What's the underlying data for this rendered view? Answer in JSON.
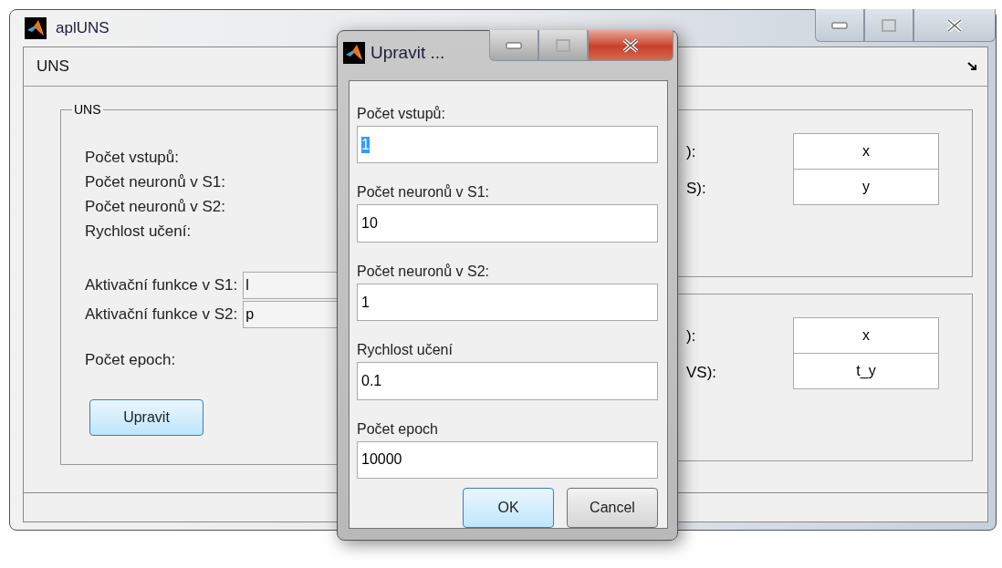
{
  "main_window": {
    "title": "aplUNS",
    "active": false,
    "menu": "UNS",
    "group": {
      "title": "UNS",
      "rows": [
        {
          "kind": "label",
          "label": "Počet vstupů:"
        },
        {
          "kind": "label",
          "label": "Počet neuronů v S1:"
        },
        {
          "kind": "label",
          "label": "Počet neuronů v S2:"
        },
        {
          "kind": "label",
          "label": "Rychlost učení:"
        },
        {
          "kind": "combo",
          "label": "Aktivační funkce v S1:",
          "value": "l"
        },
        {
          "kind": "combo",
          "label": "Aktivační funkce v S2:",
          "value": "p"
        },
        {
          "kind": "label",
          "label": "Počet epoch:"
        }
      ],
      "button": "Upravit"
    },
    "right_groups": [
      {
        "labels": [
          "):",
          "S):"
        ],
        "fields": [
          "x",
          "y"
        ]
      },
      {
        "labels": [
          "):",
          "VS):"
        ],
        "fields": [
          "x",
          "t_y"
        ]
      }
    ]
  },
  "dialog": {
    "title": "Upravit ...",
    "active": true,
    "fields": [
      {
        "label": "Počet vstupů:",
        "value": "1",
        "selected": true
      },
      {
        "label": "Počet neuronů v S1:",
        "value": "10",
        "selected": false
      },
      {
        "label": "Počet neuronů v S2:",
        "value": "1",
        "selected": false
      },
      {
        "label": "Rychlost učení",
        "value": "0.1",
        "selected": false
      },
      {
        "label": "Počet epoch",
        "value": "10000",
        "selected": false
      }
    ],
    "buttons": [
      {
        "label": "OK",
        "default": true
      },
      {
        "label": "Cancel",
        "default": false
      }
    ]
  }
}
